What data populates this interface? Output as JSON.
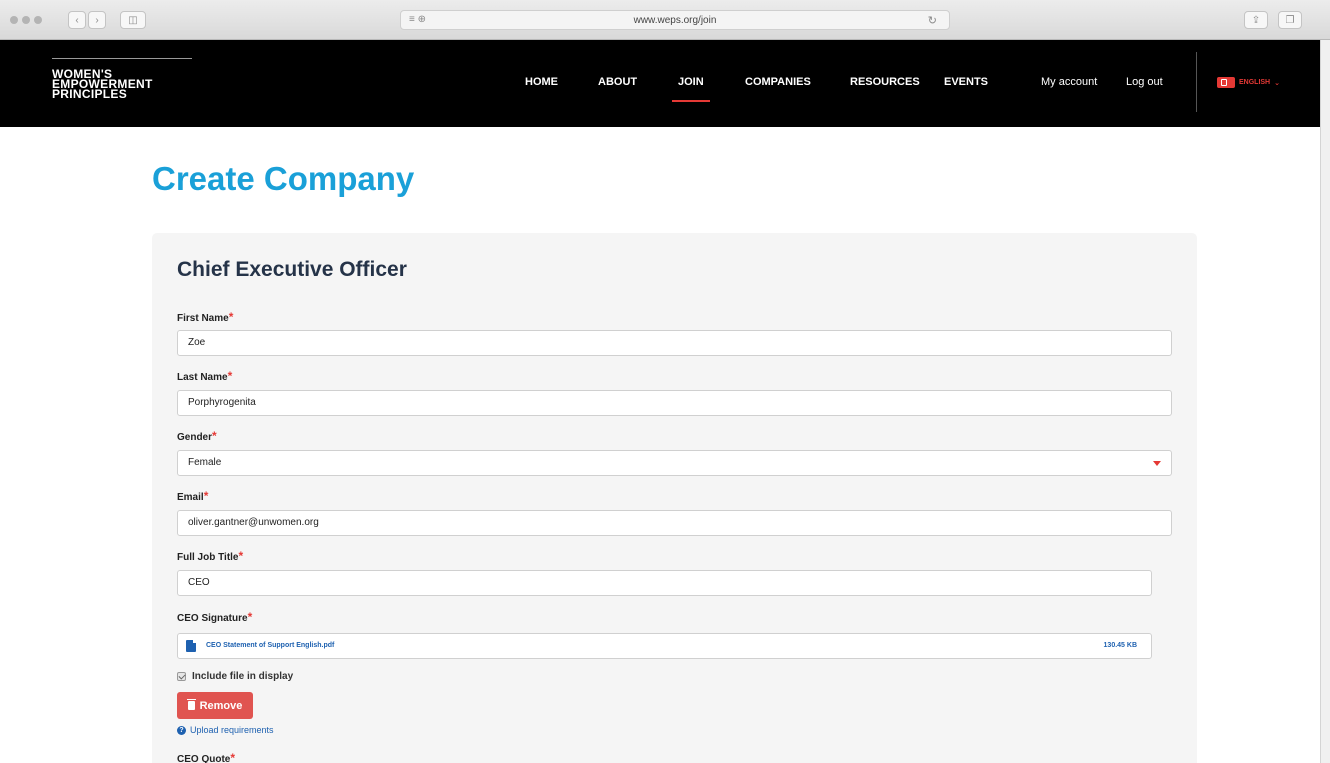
{
  "browser": {
    "url": "www.weps.org/join",
    "back_icon": "chevron-left-icon",
    "forward_icon": "chevron-right-icon"
  },
  "header": {
    "logo_lines": [
      "WOMEN'S",
      "EMPOWERMENT",
      "PRINCIPLES"
    ],
    "nav": {
      "home": "HOME",
      "about": "ABOUT",
      "join": "JOIN",
      "companies": "COMPANIES",
      "resources": "RESOURCES",
      "events": "EVENTS",
      "my_account": "My account",
      "log_out": "Log out"
    },
    "language": "ENGLISH"
  },
  "page": {
    "title": "Create Company"
  },
  "form": {
    "section_title": "Chief Executive Officer",
    "required_marker": "*",
    "first_name": {
      "label": "First Name",
      "value": "Zoe"
    },
    "last_name": {
      "label": "Last Name",
      "value": "Porphyrogenita"
    },
    "gender": {
      "label": "Gender",
      "value": "Female"
    },
    "email": {
      "label": "Email",
      "value": "oliver.gantner@unwomen.org"
    },
    "job_title": {
      "label": "Full Job Title",
      "value": "CEO"
    },
    "signature": {
      "label": "CEO Signature",
      "file_name": "CEO Statement of Support English.pdf",
      "file_size": "130.45 KB",
      "include_label": "Include file in display",
      "remove_label": "Remove",
      "upload_requirements": "Upload requirements"
    },
    "quote": {
      "label": "CEO Quote"
    }
  },
  "colors": {
    "accent_red": "#e53935",
    "title_blue": "#1aa0d8",
    "link_blue": "#1e61b0"
  }
}
